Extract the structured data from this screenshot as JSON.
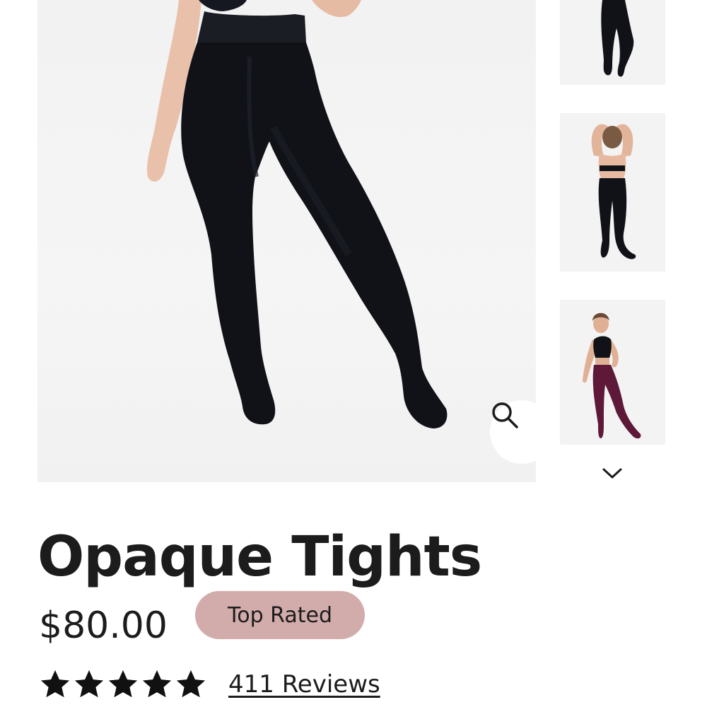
{
  "gallery": {
    "main_image_icon": "tights-model-photo",
    "zoom_icon": "search-icon",
    "thumbnails": [
      {
        "icon": "black-tights-side-photo"
      },
      {
        "icon": "black-tights-back-photo"
      },
      {
        "icon": "burgundy-tights-front-photo"
      }
    ],
    "scroll_icon": "chevron-down-icon"
  },
  "product": {
    "title": "Opaque Tights",
    "price": "$80.00",
    "badge": "Top Rated",
    "rating": 5,
    "reviews_label": "411 Reviews"
  },
  "colors": {
    "badge_bg": "#d2acab",
    "text": "#1c1c1c",
    "tights_black": "#101218",
    "tights_burgundy": "#5e1838"
  }
}
